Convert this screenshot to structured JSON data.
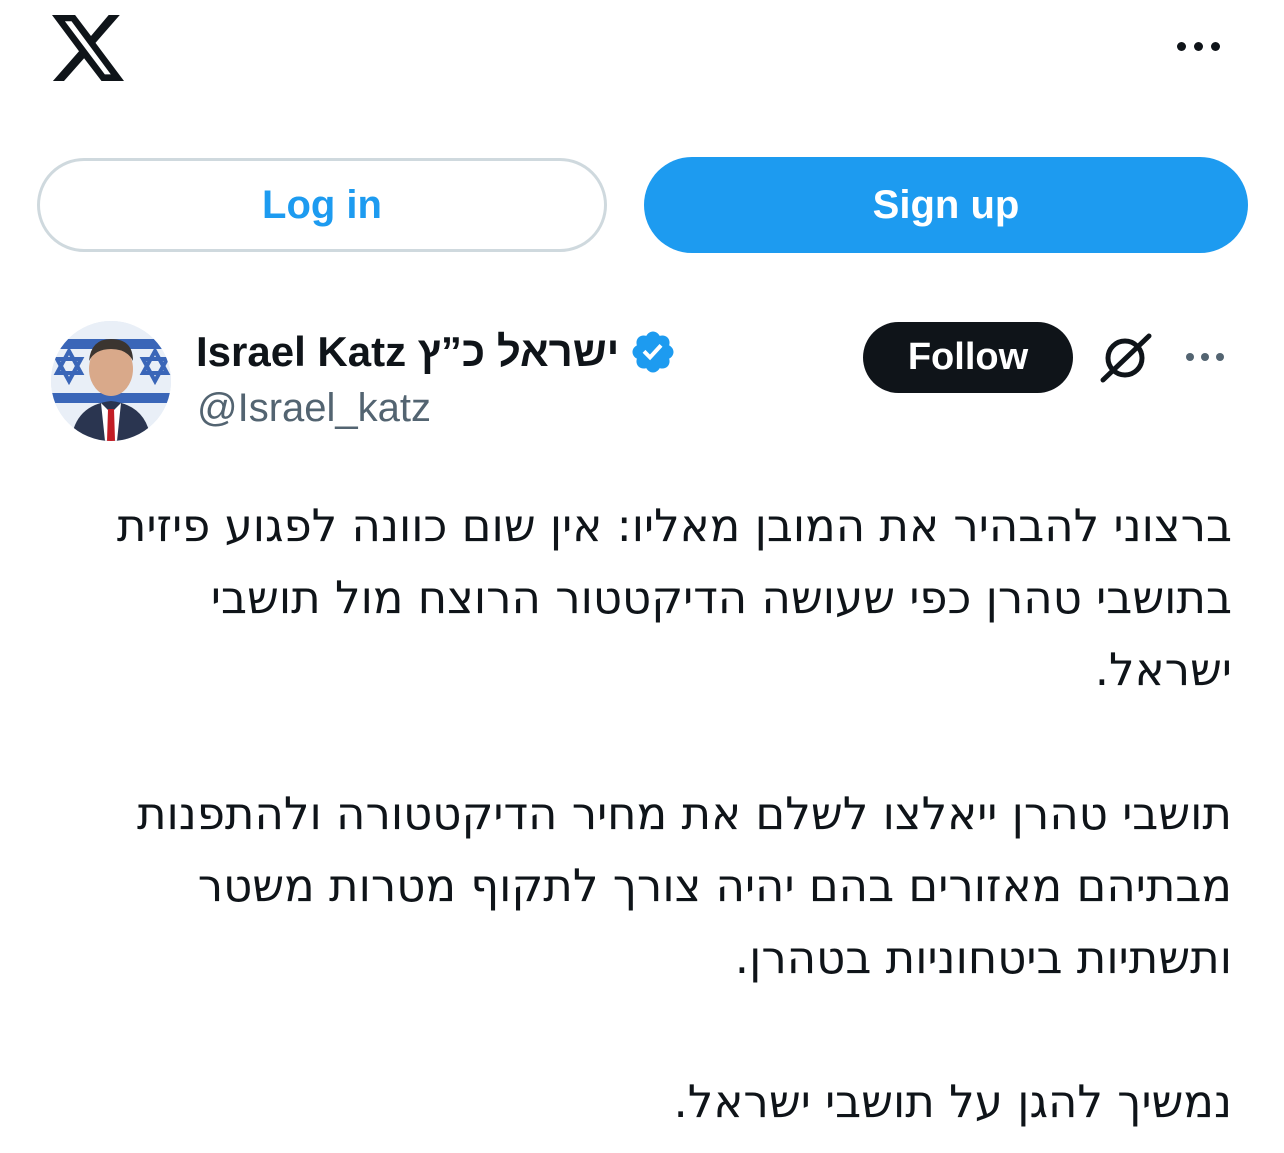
{
  "header": {
    "logo_icon": "x-logo-icon",
    "more_icon": "more-horizontal-icon"
  },
  "auth": {
    "login_label": "Log in",
    "signup_label": "Sign up"
  },
  "tweet": {
    "author": {
      "name": "Israel Katz ישראל כ”ץ",
      "handle": "@Israel_katz",
      "verified_icon": "verified-badge-icon"
    },
    "follow_label": "Follow",
    "grok_icon": "grok-icon",
    "more_icon": "more-horizontal-icon",
    "paragraphs": [
      "ברצוני להבהיר את המובן מאליו: אין שום כוונה לפגוע פיזית\nבתושבי טהרן כפי שעושה הדיקטטור הרוצח מול תושבי\nישראל.",
      "תושבי טהרן ייאלצו לשלם את מחיר הדיקטטורה ולהתפנות\nמבתיהם מאזורים בהם יהיה צורך לתקוף מטרות משטר\nותשתיות ביטחוניות בטהרן.",
      "נמשיך להגן על תושבי ישראל."
    ]
  },
  "colors": {
    "accent": "#1d9bf0",
    "text": "#0f1419",
    "muted": "#536471",
    "border": "#cfd9de"
  }
}
